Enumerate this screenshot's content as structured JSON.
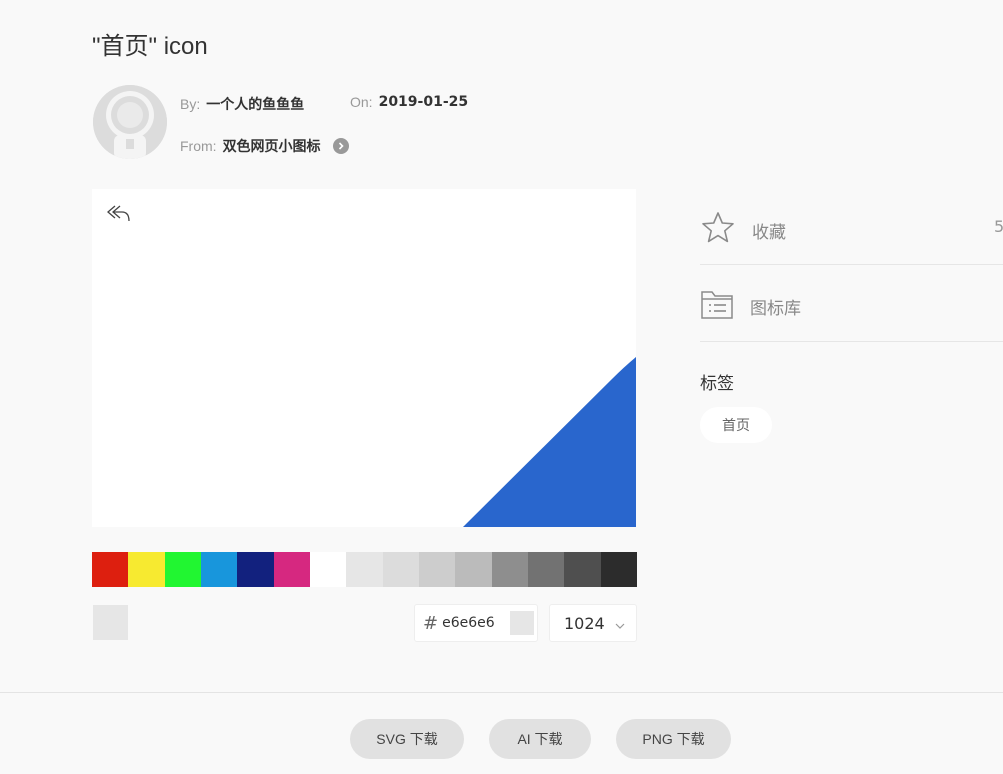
{
  "title": "\"首页\" icon",
  "author": {
    "label": "By:",
    "name": "一个人的鱼鱼鱼"
  },
  "date": {
    "label": "On:",
    "value": "2019-01-25"
  },
  "source": {
    "label": "From:",
    "name": "双色网页小图标"
  },
  "preview": {
    "icon_color": "#2966cd"
  },
  "palette": [
    "#dd1f0f",
    "#f7ea30",
    "#21f631",
    "#1896dc",
    "#12217e",
    "#d62880",
    "#ffffff",
    "#e6e6e6",
    "#dcdcdc",
    "#cdcdcd",
    "#bbbbbb",
    "#8e8e8e",
    "#727272",
    "#4f4f4f",
    "#2c2c2c"
  ],
  "color_picker": {
    "hash": "#",
    "value": "e6e6e6",
    "current_color": "#e6e6e6"
  },
  "size_select": {
    "value": "1024"
  },
  "sidebar": {
    "favorite": {
      "label": "收藏",
      "count": "5"
    },
    "library": {
      "label": "图标库"
    },
    "tags_title": "标签",
    "tags": [
      "首页"
    ]
  },
  "downloads": {
    "svg": "SVG 下载",
    "ai": "AI 下载",
    "png": "PNG 下载"
  }
}
